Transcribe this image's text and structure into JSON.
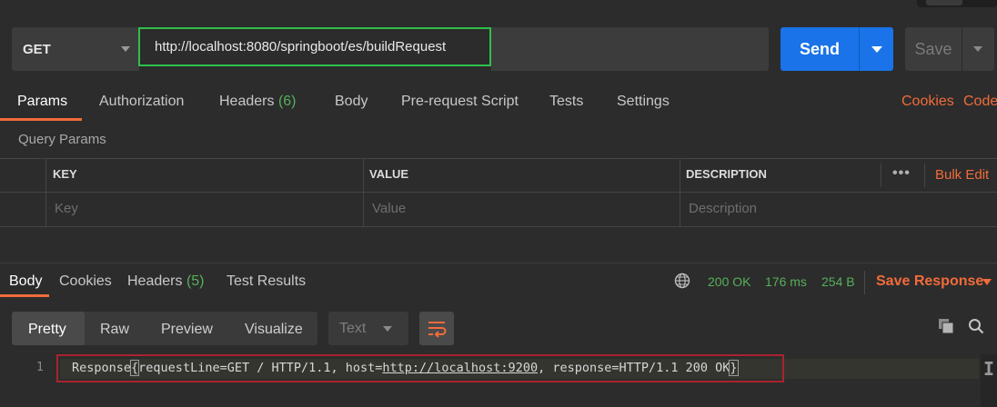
{
  "request": {
    "method": "GET",
    "url": "http://localhost:8080/springboot/es/buildRequest",
    "send_label": "Send",
    "save_label": "Save"
  },
  "request_tabs": {
    "params": "Params",
    "authorization": "Authorization",
    "headers": "Headers",
    "headers_count": "(6)",
    "body": "Body",
    "pre_request": "Pre-request Script",
    "tests": "Tests",
    "settings": "Settings",
    "cookies": "Cookies",
    "code": "Code"
  },
  "query_params": {
    "title": "Query Params",
    "columns": [
      "KEY",
      "VALUE",
      "DESCRIPTION"
    ],
    "placeholders": {
      "key": "Key",
      "value": "Value",
      "description": "Description"
    },
    "more": "•••",
    "bulk_edit": "Bulk Edit"
  },
  "response_tabs": {
    "body": "Body",
    "cookies": "Cookies",
    "headers": "Headers",
    "headers_count": "(5)",
    "test_results": "Test Results"
  },
  "status": {
    "code": "200 OK",
    "time": "176 ms",
    "size": "254 B",
    "save_response": "Save Response"
  },
  "view": {
    "modes": [
      "Pretty",
      "Raw",
      "Preview",
      "Visualize"
    ],
    "format": "Text"
  },
  "editor": {
    "line_number": "1",
    "pre": "Response",
    "open_brace": "{",
    "mid": "requestLine=GET / HTTP/1.1, host=",
    "link": "http://localhost:9200",
    "post": ", response=HTTP/1.1 200 OK",
    "close_brace": "}"
  },
  "colors": {
    "accent": "#f26b3a",
    "send": "#1a73e8",
    "ok": "#56b05a",
    "highlight_box": "#a8242e",
    "url_border": "#2fbf4a"
  },
  "icons": [
    "chevron-down-icon",
    "globe-icon",
    "copy-icon",
    "search-icon",
    "wrap-lines-icon",
    "more-icon"
  ]
}
